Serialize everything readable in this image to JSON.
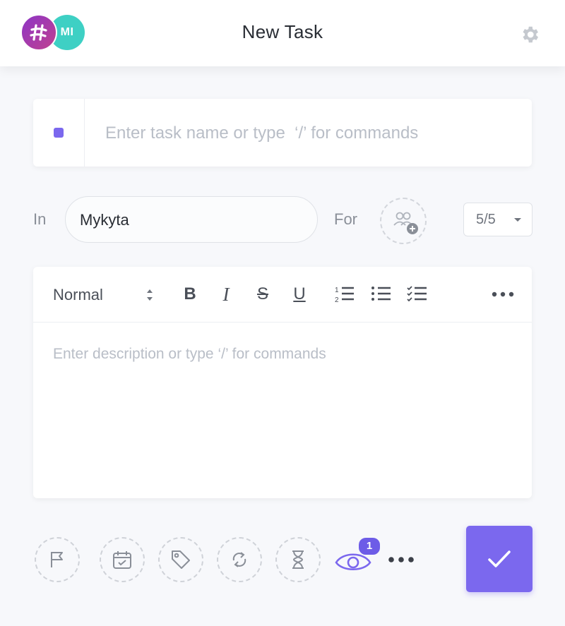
{
  "header": {
    "title": "New Task",
    "avatars": [
      {
        "icon": "clickup-logo-avatar",
        "color": "#8d35c6"
      },
      {
        "initials": "MI",
        "color": "#3ed0c4"
      }
    ],
    "settings_icon": "gear-icon"
  },
  "task": {
    "status_color": "#7b68ee",
    "name_value": "",
    "name_placeholder": "Enter task name or type  ‘/’ for commands"
  },
  "location": {
    "in_label": "In",
    "list_name": "Mykyta",
    "for_label": "For",
    "assignee_icon": "add-assignee-icon",
    "counter": "5/5"
  },
  "editor": {
    "text_style": "Normal",
    "toolbar_icons": [
      "bold",
      "italic",
      "strikethrough",
      "underline",
      "numbered-list",
      "bulleted-list",
      "checklist",
      "more"
    ],
    "toolbar_glyphs": {
      "bold": "B",
      "italic": "I",
      "strike": "S",
      "underline": "U"
    },
    "description_placeholder": "Enter description or type ‘/’ for commands"
  },
  "actions": {
    "icons": [
      "flag-icon",
      "calendar-icon",
      "tag-icon",
      "repeat-icon",
      "hourglass-icon",
      "eye-icon",
      "more-icon"
    ],
    "watchers_count": "1",
    "accent": "#7b68ee"
  }
}
